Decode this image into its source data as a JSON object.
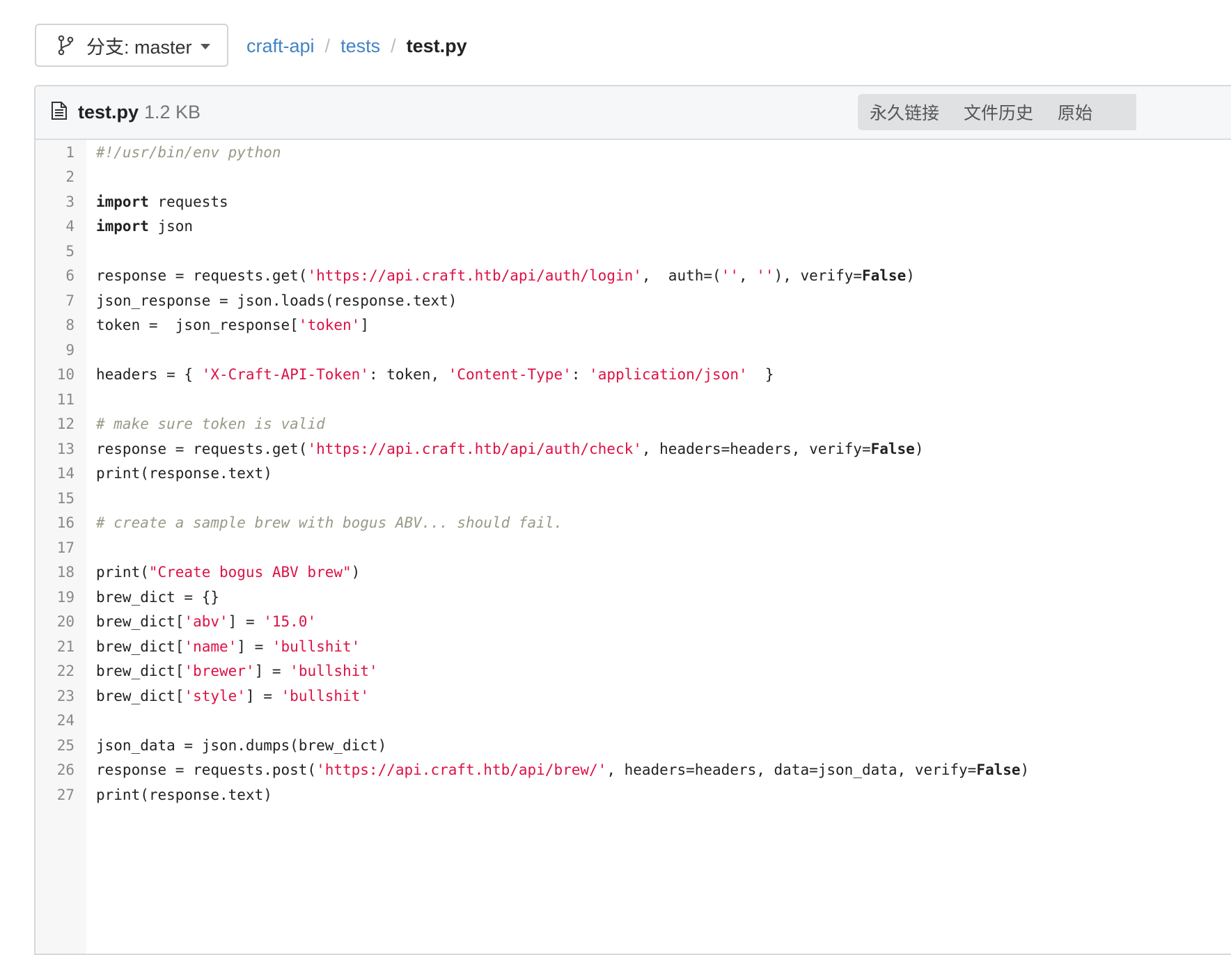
{
  "branch": {
    "label": "分支: master"
  },
  "breadcrumb": {
    "items": [
      "craft-api",
      "tests"
    ],
    "separator": "/",
    "current": "test.py"
  },
  "file": {
    "name": "test.py",
    "size": "1.2 KB"
  },
  "actions": [
    "永久链接",
    "文件历史",
    "原始"
  ],
  "colors": {
    "link": "#4183c4",
    "string": "#dd1144",
    "comment": "#999988"
  },
  "code_lines": [
    [
      [
        "com",
        "#!/usr/bin/env python"
      ]
    ],
    [],
    [
      [
        "kw",
        "import"
      ],
      [
        "plain",
        " requests"
      ]
    ],
    [
      [
        "kw",
        "import"
      ],
      [
        "plain",
        " json"
      ]
    ],
    [],
    [
      [
        "plain",
        "response = requests.get("
      ],
      [
        "str",
        "'https://api.craft.htb/api/auth/login'"
      ],
      [
        "plain",
        ",  auth=("
      ],
      [
        "str",
        "''"
      ],
      [
        "plain",
        ", "
      ],
      [
        "str",
        "''"
      ],
      [
        "plain",
        "), verify="
      ],
      [
        "const",
        "False"
      ],
      [
        "plain",
        ")"
      ]
    ],
    [
      [
        "plain",
        "json_response = json.loads(response.text)"
      ]
    ],
    [
      [
        "plain",
        "token =  json_response["
      ],
      [
        "str",
        "'token'"
      ],
      [
        "plain",
        "]"
      ]
    ],
    [],
    [
      [
        "plain",
        "headers = { "
      ],
      [
        "str",
        "'X-Craft-API-Token'"
      ],
      [
        "plain",
        ": token, "
      ],
      [
        "str",
        "'Content-Type'"
      ],
      [
        "plain",
        ": "
      ],
      [
        "str",
        "'application/json'"
      ],
      [
        "plain",
        "  }"
      ]
    ],
    [],
    [
      [
        "com",
        "# make sure token is valid"
      ]
    ],
    [
      [
        "plain",
        "response = requests.get("
      ],
      [
        "str",
        "'https://api.craft.htb/api/auth/check'"
      ],
      [
        "plain",
        ", headers=headers, verify="
      ],
      [
        "const",
        "False"
      ],
      [
        "plain",
        ")"
      ]
    ],
    [
      [
        "plain",
        "print(response.text)"
      ]
    ],
    [],
    [
      [
        "com",
        "# create a sample brew with bogus ABV... should fail."
      ]
    ],
    [],
    [
      [
        "plain",
        "print("
      ],
      [
        "str",
        "\"Create bogus ABV brew\""
      ],
      [
        "plain",
        ")"
      ]
    ],
    [
      [
        "plain",
        "brew_dict = {}"
      ]
    ],
    [
      [
        "plain",
        "brew_dict["
      ],
      [
        "str",
        "'abv'"
      ],
      [
        "plain",
        "] = "
      ],
      [
        "str",
        "'15.0'"
      ]
    ],
    [
      [
        "plain",
        "brew_dict["
      ],
      [
        "str",
        "'name'"
      ],
      [
        "plain",
        "] = "
      ],
      [
        "str",
        "'bullshit'"
      ]
    ],
    [
      [
        "plain",
        "brew_dict["
      ],
      [
        "str",
        "'brewer'"
      ],
      [
        "plain",
        "] = "
      ],
      [
        "str",
        "'bullshit'"
      ]
    ],
    [
      [
        "plain",
        "brew_dict["
      ],
      [
        "str",
        "'style'"
      ],
      [
        "plain",
        "] = "
      ],
      [
        "str",
        "'bullshit'"
      ]
    ],
    [],
    [
      [
        "plain",
        "json_data = json.dumps(brew_dict)"
      ]
    ],
    [
      [
        "plain",
        "response = requests.post("
      ],
      [
        "str",
        "'https://api.craft.htb/api/brew/'"
      ],
      [
        "plain",
        ", headers=headers, data=json_data, verify="
      ],
      [
        "const",
        "False"
      ],
      [
        "plain",
        ")"
      ]
    ],
    [
      [
        "plain",
        "print(response.text)"
      ]
    ]
  ]
}
